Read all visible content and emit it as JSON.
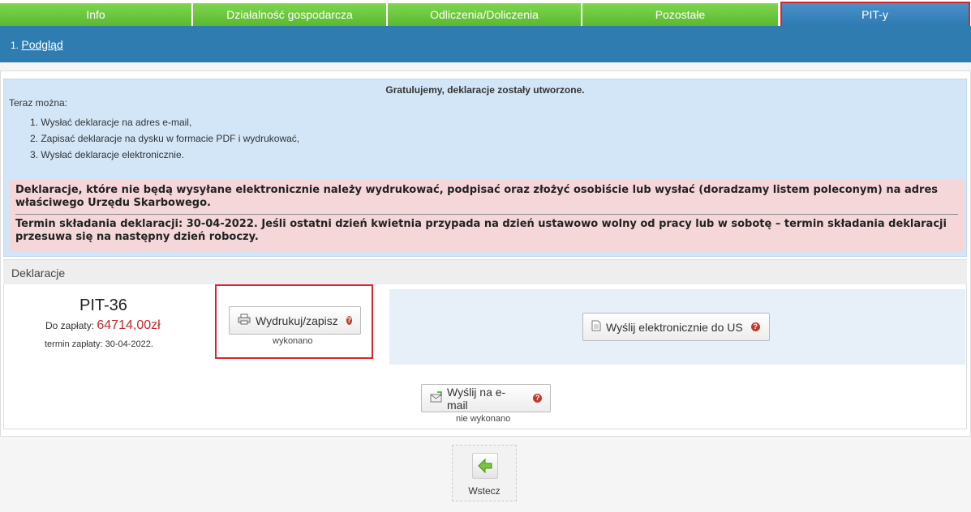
{
  "tabs": [
    {
      "label": "Info"
    },
    {
      "label": "Działalność gospodarcza"
    },
    {
      "label": "Odliczenia/Doliczenia"
    },
    {
      "label": "Pozostałe"
    },
    {
      "label": "PIT-y",
      "active": true
    }
  ],
  "breadcrumb": {
    "number": "1.",
    "link": "Podgląd"
  },
  "info": {
    "congrats": "Gratulujemy, deklaracje zostały utworzone.",
    "now": "Teraz można:",
    "steps": [
      "1. Wysłać deklaracje na adres e-mail,",
      "2. Zapisać deklaracje na dysku w formacie PDF i wydrukować,",
      "3. Wysłać deklaracje elektronicznie."
    ],
    "warning1": "Deklaracje, które nie będą wysyłane elektronicznie należy wydrukować, podpisać oraz złożyć osobiście lub wysłać (doradzamy listem poleconym) na adres właściwego Urzędu Skarbowego.",
    "warning2": "Termin składania deklaracji: 30-04-2022. Jeśli ostatni dzień kwietnia przypada na dzień ustawowo wolny od pracy lub w sobotę – termin składania deklaracji przesuwa się na następny dzień roboczy."
  },
  "declarations": {
    "header": "Deklaracje",
    "pit": "PIT-36",
    "pay_label": "Do zapłaty:",
    "pay_amount": "64714,00zł",
    "due": "termin zapłaty: 30-04-2022.",
    "print_button": "Wydrukuj/zapisz",
    "print_status": "wykonano",
    "send_us_button": "Wyślij elektronicznie do US",
    "email_button": "Wyślij na e-mail",
    "email_status": "nie wykonano"
  },
  "help_glyph": "?",
  "back": {
    "label": "Wstecz"
  },
  "colors": {
    "tab_green": "#6cc644",
    "tab_active": "#3a86be",
    "subbar": "#2e7cb0",
    "amount_red": "#c0292b",
    "highlight_red": "#d9262d"
  }
}
